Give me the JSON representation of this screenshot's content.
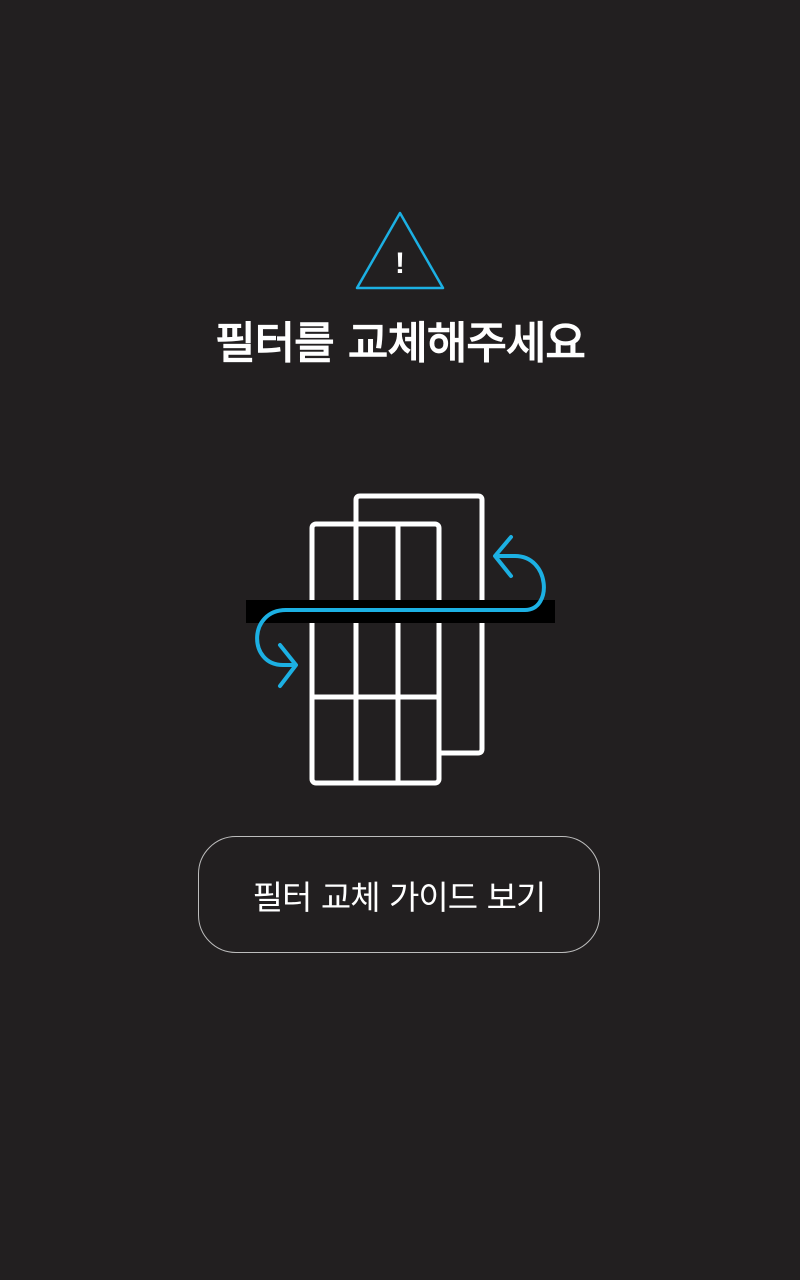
{
  "alert": {
    "icon": "warning-triangle-icon",
    "icon_color": "#1cb0e3",
    "icon_mark": "!",
    "title": "필터를 교체해주세요"
  },
  "illustration": {
    "icon": "filter-rotate-icon",
    "line_color": "#ffffff",
    "arrow_color": "#1cb0e3"
  },
  "guide_button": {
    "label": "필터 교체 가이드 보기"
  },
  "colors": {
    "background": "#221f20",
    "accent": "#1cb0e3",
    "button_border": "#bdbdbd"
  }
}
